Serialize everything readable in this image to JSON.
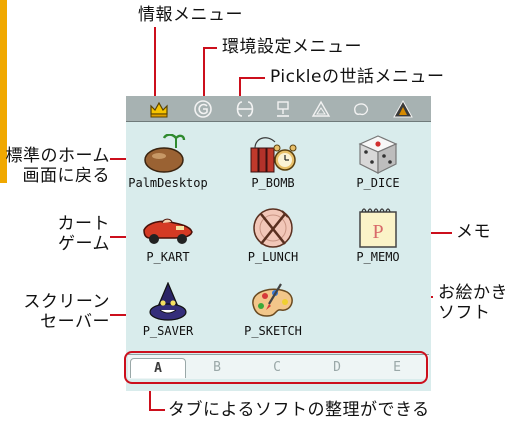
{
  "callouts": {
    "info_menu": "情報メニュー",
    "env_settings_menu": "環境設定メニュー",
    "pickle_menu": "Pickleの世話メニュー",
    "return_home_line1": "標準のホーム",
    "return_home_line2": "画面に戻る",
    "cart_game_line1": "カート",
    "cart_game_line2": "ゲーム",
    "screensaver_line1": "スクリーン",
    "screensaver_line2": "セーバー",
    "memo": "メモ",
    "drawing_line1": "お絵かき",
    "drawing_line2": "ソフト",
    "tab_organize": "タブによるソフトの整理ができる"
  },
  "toolbar_icons": [
    "crown-icon",
    "spiral-g-icon",
    "pickle-face-icon",
    "plant-icon",
    "triangle-outline-icon",
    "blob-icon",
    "triangle-filled-icon"
  ],
  "apps": [
    {
      "name": "PalmDesktop",
      "icon": "palm-desktop-icon"
    },
    {
      "name": "P_BOMB",
      "icon": "bomb-icon"
    },
    {
      "name": "P_DICE",
      "icon": "dice-icon"
    },
    {
      "name": "P_KART",
      "icon": "kart-icon"
    },
    {
      "name": "P_LUNCH",
      "icon": "lunch-icon"
    },
    {
      "name": "P_MEMO",
      "icon": "memo-icon"
    },
    {
      "name": "P_SAVER",
      "icon": "saver-icon"
    },
    {
      "name": "P_SKETCH",
      "icon": "sketch-icon"
    }
  ],
  "memo_letter": "P",
  "tabs": [
    "A",
    "B",
    "C",
    "D",
    "E"
  ],
  "active_tab": "A",
  "colors": {
    "accent": "#cc0f1c",
    "screen_bg": "#d9ecec",
    "toolbar_bg": "#a7b2b2",
    "orange_bar": "#f0a800"
  }
}
